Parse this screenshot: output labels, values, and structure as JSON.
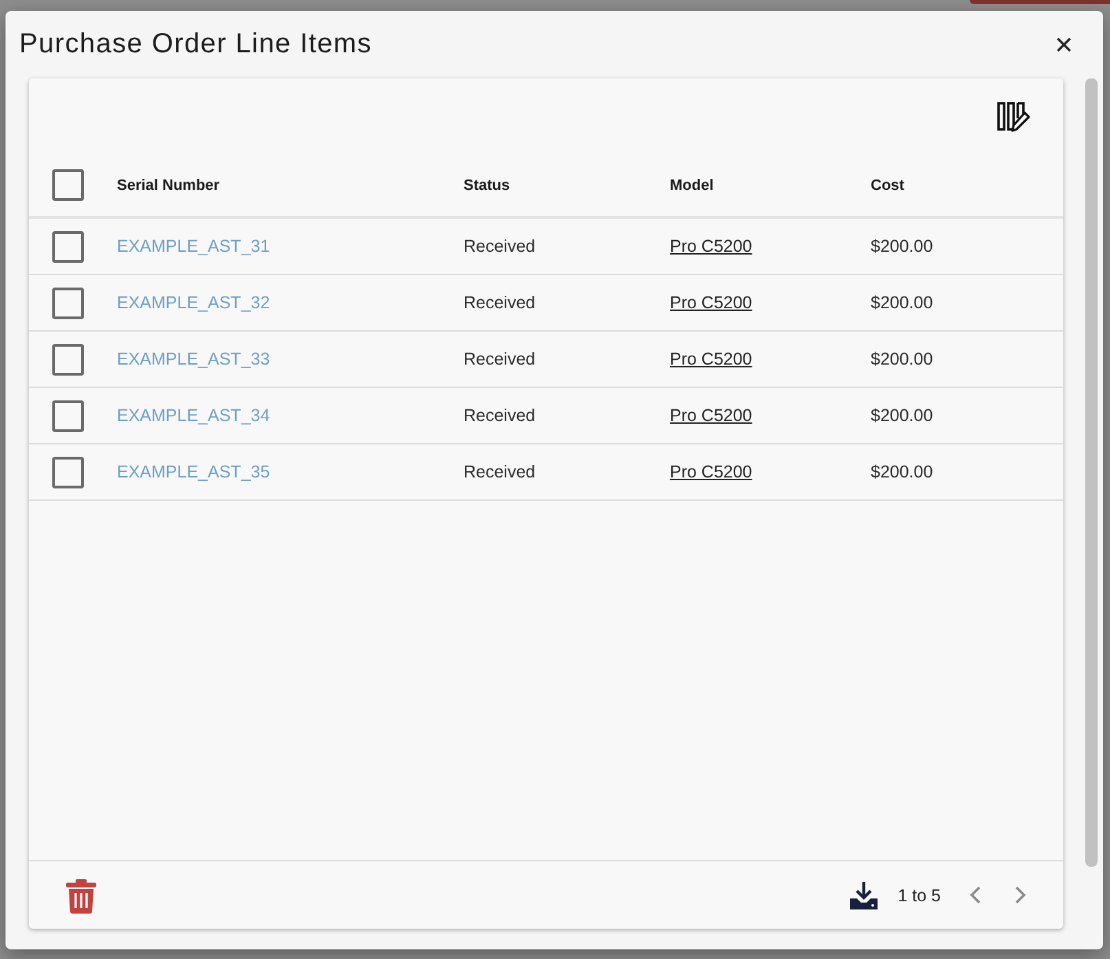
{
  "dialog": {
    "title": "Purchase Order Line Items"
  },
  "table": {
    "columns": [
      "Serial Number",
      "Status",
      "Model",
      "Cost"
    ],
    "select_all": {
      "checked": false
    },
    "rows": [
      {
        "checked": false,
        "serial_number": "EXAMPLE_AST_31",
        "status": "Received",
        "model": "Pro C5200",
        "cost": "$200.00"
      },
      {
        "checked": false,
        "serial_number": "EXAMPLE_AST_32",
        "status": "Received",
        "model": "Pro C5200",
        "cost": "$200.00"
      },
      {
        "checked": false,
        "serial_number": "EXAMPLE_AST_33",
        "status": "Received",
        "model": "Pro C5200",
        "cost": "$200.00"
      },
      {
        "checked": false,
        "serial_number": "EXAMPLE_AST_34",
        "status": "Received",
        "model": "Pro C5200",
        "cost": "$200.00"
      },
      {
        "checked": false,
        "serial_number": "EXAMPLE_AST_35",
        "status": "Received",
        "model": "Pro C5200",
        "cost": "$200.00"
      }
    ]
  },
  "pagination": {
    "range": "1 to 5",
    "prev_disabled": true,
    "next_disabled": true
  }
}
